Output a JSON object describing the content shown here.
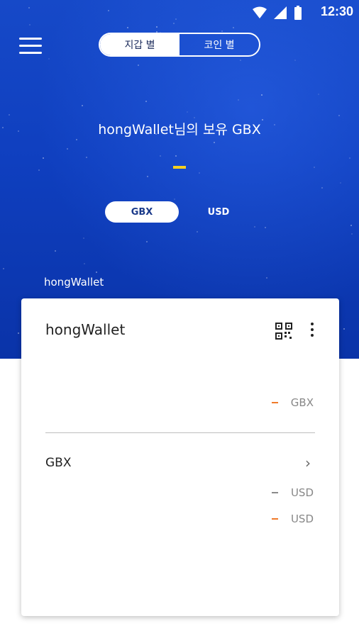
{
  "status_bar": {
    "time": "12:30",
    "icons": [
      "wifi-icon",
      "signal-icon",
      "battery-icon"
    ]
  },
  "top_nav": {
    "menu_icon": "hamburger-menu-icon",
    "tabs": [
      {
        "label": "지갑 별",
        "active": true
      },
      {
        "label": "코인 별",
        "active": false
      }
    ]
  },
  "summary": {
    "headline": "hongWallet님의 보유 GBX",
    "amount": "-"
  },
  "unit_toggle": {
    "options": [
      {
        "label": "GBX",
        "active": true
      },
      {
        "label": "USD",
        "active": false
      }
    ]
  },
  "wallet_section_label": "hongWallet",
  "card": {
    "wallet_name": "hongWallet",
    "total": {
      "amount": "-",
      "unit": "GBX"
    },
    "coins": [
      {
        "name": "GBX",
        "value_usd": {
          "amount": "-",
          "unit": "USD"
        },
        "change_usd": {
          "amount": "-",
          "unit": "USD"
        }
      }
    ]
  },
  "colors": {
    "hero_blue": "#1246c4",
    "accent_yellow": "#f5d020",
    "accent_orange": "#f07a2a",
    "dash_gray": "#8a8a8a"
  }
}
